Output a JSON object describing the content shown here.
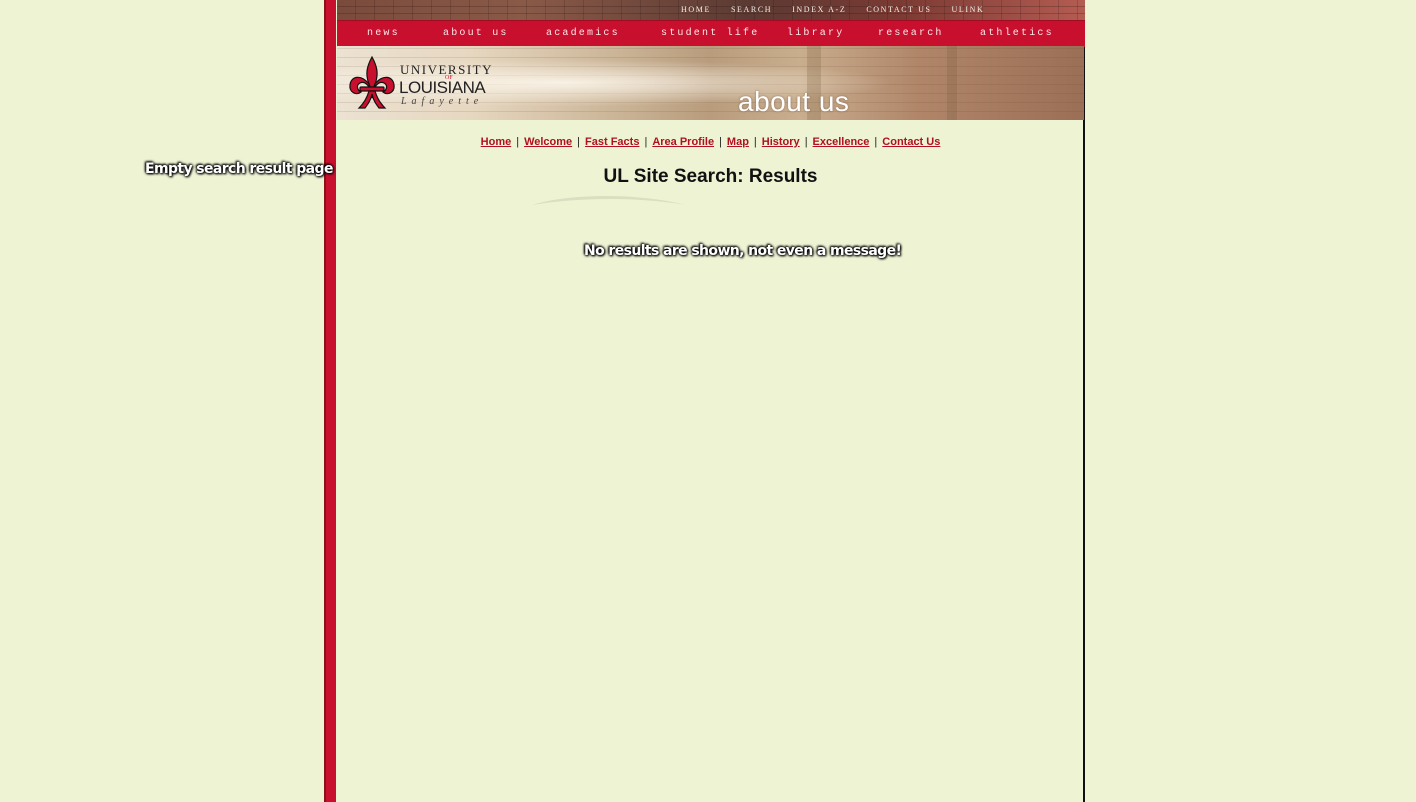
{
  "annotations": {
    "left": "Empty search result page",
    "center": "No results are shown, not even a message!"
  },
  "utility_links": [
    "HOME",
    "SEARCH",
    "INDEX A-Z",
    "CONTACT US",
    "ULINK"
  ],
  "main_nav": [
    "news",
    "about us",
    "academics",
    "student life",
    "library",
    "research",
    "athletics"
  ],
  "logo": {
    "line1": "UNIVERSITY",
    "of": "OF",
    "line2": "LOUISIANA",
    "line3": "Lafayette"
  },
  "banner": {
    "title": "about us"
  },
  "sub_nav": [
    "Home",
    "Welcome",
    "Fast Facts",
    "Area Profile",
    "Map",
    "History",
    "Excellence",
    "Contact Us"
  ],
  "page_title": "UL Site Search: Results",
  "colors": {
    "brand_red": "#c8102e",
    "background": "#eef3d4",
    "link": "#b0101f"
  }
}
